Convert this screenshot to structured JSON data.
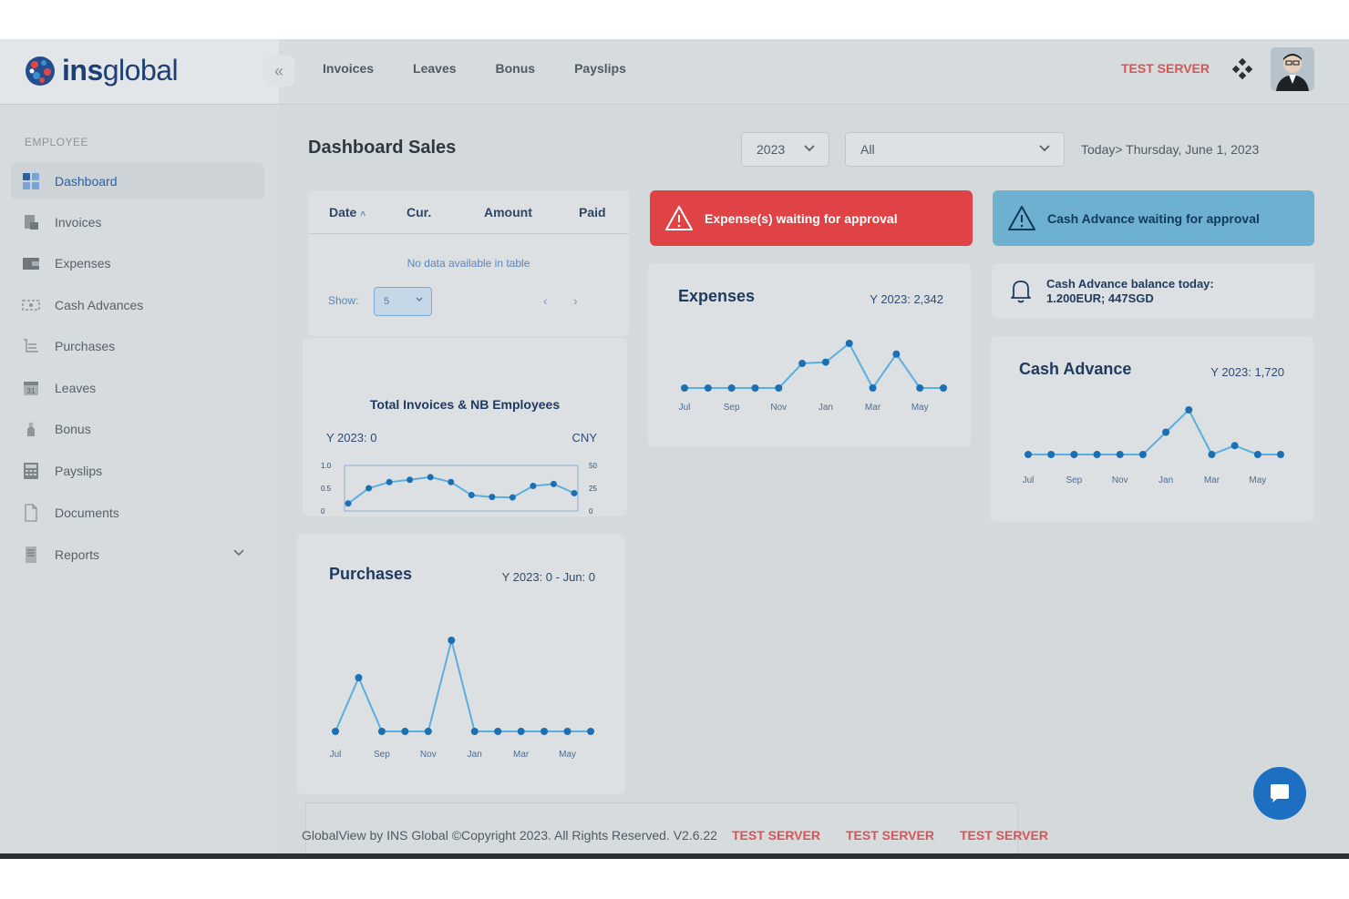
{
  "brand": {
    "name_bold": "ins",
    "name_rest": "global"
  },
  "topnav": [
    "Invoices",
    "Leaves",
    "Bonus",
    "Payslips"
  ],
  "header": {
    "server_label": "TEST SERVER",
    "apps_icon": "apps-icon",
    "avatar_icon": "user-avatar"
  },
  "sidebar": {
    "section": "EMPLOYEE",
    "items": [
      {
        "label": "Dashboard",
        "icon": "dashboard-icon"
      },
      {
        "label": "Invoices",
        "icon": "invoices-icon"
      },
      {
        "label": "Expenses",
        "icon": "wallet-icon"
      },
      {
        "label": "Cash Advances",
        "icon": "cash-icon"
      },
      {
        "label": "Purchases",
        "icon": "cart-icon"
      },
      {
        "label": "Leaves",
        "icon": "calendar-icon"
      },
      {
        "label": "Bonus",
        "icon": "bonus-icon"
      },
      {
        "label": "Payslips",
        "icon": "calculator-icon"
      },
      {
        "label": "Documents",
        "icon": "document-icon"
      },
      {
        "label": "Reports",
        "icon": "report-icon"
      }
    ]
  },
  "main": {
    "title": "Dashboard Sales",
    "year_filter": "2023",
    "scope_filter": "All",
    "today": "Today> Thursday, June 1, 2023"
  },
  "invoice_table": {
    "columns": [
      "Date",
      "Cur.",
      "Amount",
      "Paid"
    ],
    "empty_text": "No data available in table",
    "show_label": "Show:",
    "show_value": "5",
    "prev": "‹",
    "next": "›"
  },
  "alerts": {
    "expense": "Expense(s) waiting for approval",
    "cash_advance": "Cash Advance waiting for approval"
  },
  "cash_balance": {
    "line1": "Cash Advance balance today:",
    "line2": "1.200EUR; 447SGD"
  },
  "footer": {
    "copyright": "GlobalView by INS Global ©Copyright 2023. All Rights Reserved. V2.6.22",
    "server_tags": [
      "TEST SERVER",
      "TEST SERVER",
      "TEST SERVER"
    ]
  },
  "colors": {
    "accent": "#1d6fc2",
    "line": "#5aaee0",
    "point": "#1c6fb0",
    "alert_red": "#df4346",
    "alert_blue": "#6eb0d0",
    "test_server": "#d95555"
  },
  "chart_data": [
    {
      "id": "invoices",
      "type": "line",
      "title": "Total Invoices & NB Employees",
      "summary": "Y 2023: 0",
      "currency": "CNY",
      "x": [
        "Jul",
        "Aug",
        "Sep",
        "Oct",
        "Nov",
        "Dec",
        "Jan",
        "Feb",
        "Mar",
        "Apr",
        "May",
        "Jun"
      ],
      "x_tick_labels": [
        "Jul",
        "Sep",
        "Nov",
        "Jan",
        "Mar",
        "May"
      ],
      "y_left": {
        "ticks": [
          "1.0",
          "0.5",
          "0"
        ],
        "ylim": [
          0,
          1
        ]
      },
      "y_right": {
        "ticks": [
          "50",
          "25",
          "0"
        ],
        "ylim": [
          0,
          50
        ]
      },
      "series": [
        {
          "values": [
            0.1,
            0.5,
            0.66,
            0.72,
            0.79,
            0.66,
            0.32,
            0.27,
            0.26,
            0.56,
            0.61,
            0.37
          ]
        }
      ],
      "grid": false
    },
    {
      "id": "expenses",
      "type": "line",
      "title": "Expenses",
      "summary": "Y 2023: 2,342",
      "x": [
        "Jul",
        "Aug",
        "Sep",
        "Oct",
        "Nov",
        "Dec",
        "Jan",
        "Feb",
        "Mar",
        "Apr",
        "May",
        "Jun"
      ],
      "x_tick_labels": [
        "Jul",
        "Sep",
        "Nov",
        "Jan",
        "Mar",
        "May"
      ],
      "series": [
        {
          "values": [
            0,
            0,
            0,
            0,
            0,
            0.55,
            0.58,
            1.0,
            0,
            0.76,
            0,
            0
          ]
        }
      ],
      "grid": false
    },
    {
      "id": "cash_advance",
      "type": "line",
      "title": "Cash Advance",
      "summary": "Y 2023: 1,720",
      "x": [
        "Jul",
        "Aug",
        "Sep",
        "Oct",
        "Nov",
        "Dec",
        "Jan",
        "Feb",
        "Mar",
        "Apr",
        "May",
        "Jun"
      ],
      "x_tick_labels": [
        "Jul",
        "Sep",
        "Nov",
        "Jan",
        "Mar",
        "May"
      ],
      "series": [
        {
          "values": [
            0,
            0,
            0,
            0,
            0,
            0,
            0.5,
            1.0,
            0,
            0.2,
            0,
            0
          ]
        }
      ],
      "grid": false
    },
    {
      "id": "purchases",
      "type": "line",
      "title": "Purchases",
      "summary": "Y 2023: 0 - Jun: 0",
      "x": [
        "Jul",
        "Aug",
        "Sep",
        "Oct",
        "Nov",
        "Dec",
        "Jan",
        "Feb",
        "Mar",
        "Apr",
        "May",
        "Jun"
      ],
      "x_tick_labels": [
        "Jul",
        "Sep",
        "Nov",
        "Jan",
        "Mar",
        "May"
      ],
      "series": [
        {
          "values": [
            0,
            0.59,
            0,
            0,
            0,
            1.0,
            0,
            0,
            0,
            0,
            0,
            0
          ]
        }
      ],
      "grid": false
    }
  ]
}
